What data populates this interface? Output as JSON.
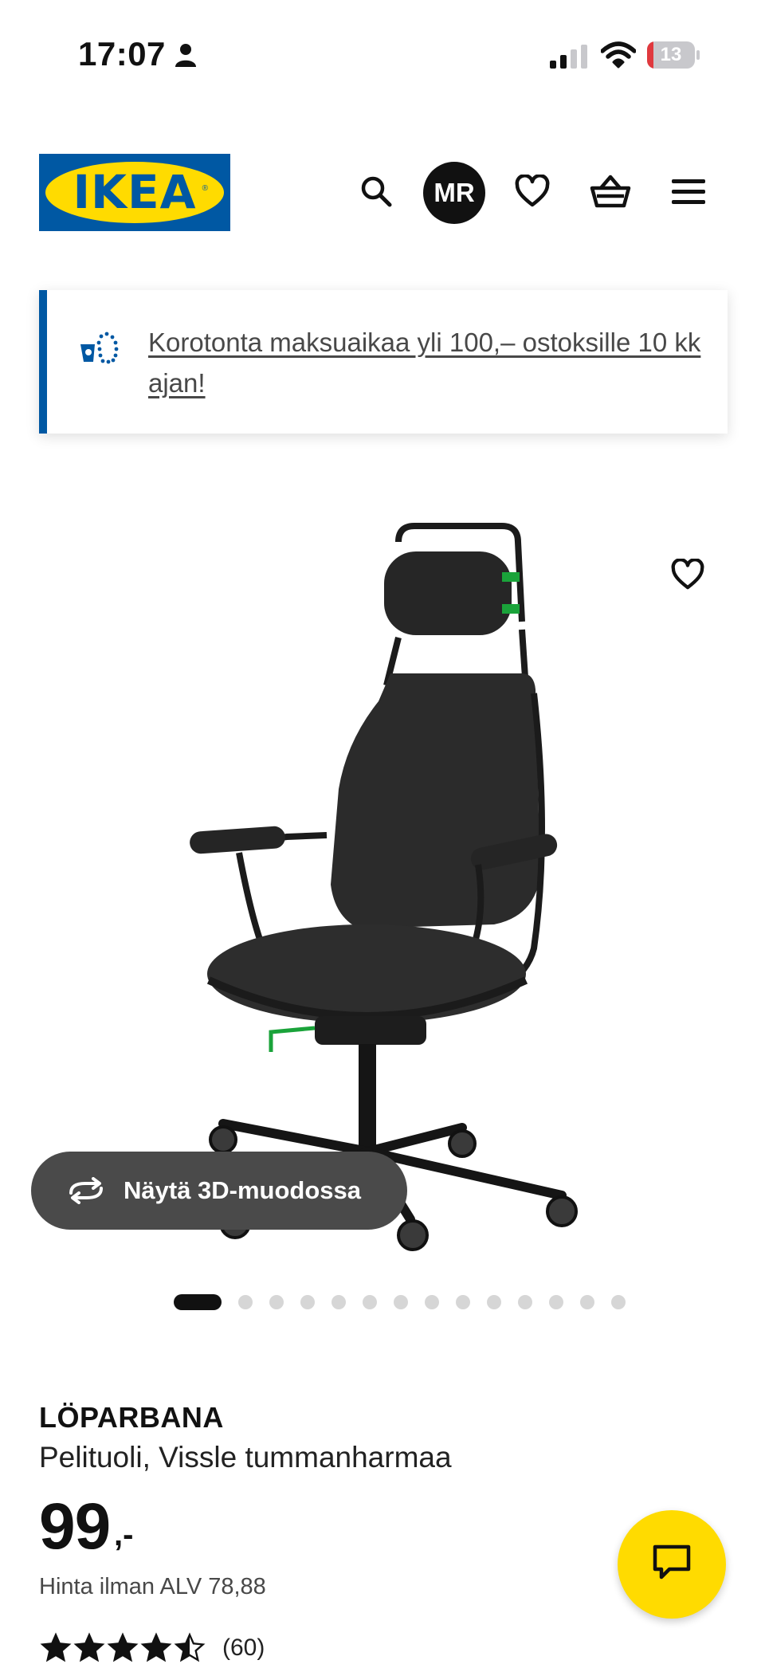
{
  "status_bar": {
    "time": "17:07",
    "battery": "13",
    "battery_level": 0.13
  },
  "header": {
    "logo_text": "IKEA",
    "avatar_initials": "MR"
  },
  "banner": {
    "text": "Korotonta maksuaikaa yli 100,– ostoksille 10 kk ajan!"
  },
  "gallery": {
    "view_3d_label": "Näytä 3D-muodossa",
    "total_images": 14,
    "active_index": 0
  },
  "product": {
    "name": "LÖPARBANA",
    "description": "Pelituoli, Vissle tummanharmaa",
    "price": "99",
    "price_suffix": ",-",
    "vat_text": "Hinta ilman ALV 78,88",
    "rating": 4.5,
    "rating_max": 5,
    "review_count": "(60)"
  },
  "colors": {
    "ikea_blue": "#0058a3",
    "ikea_yellow": "#ffdb00",
    "battery_low": "#e0393e"
  },
  "icons": [
    "person-icon",
    "signal-icon",
    "wifi-icon",
    "battery-icon",
    "search-icon",
    "heart-icon",
    "basket-icon",
    "menu-icon",
    "payment-icon",
    "rotate-3d-icon",
    "chat-icon",
    "star-icon"
  ]
}
